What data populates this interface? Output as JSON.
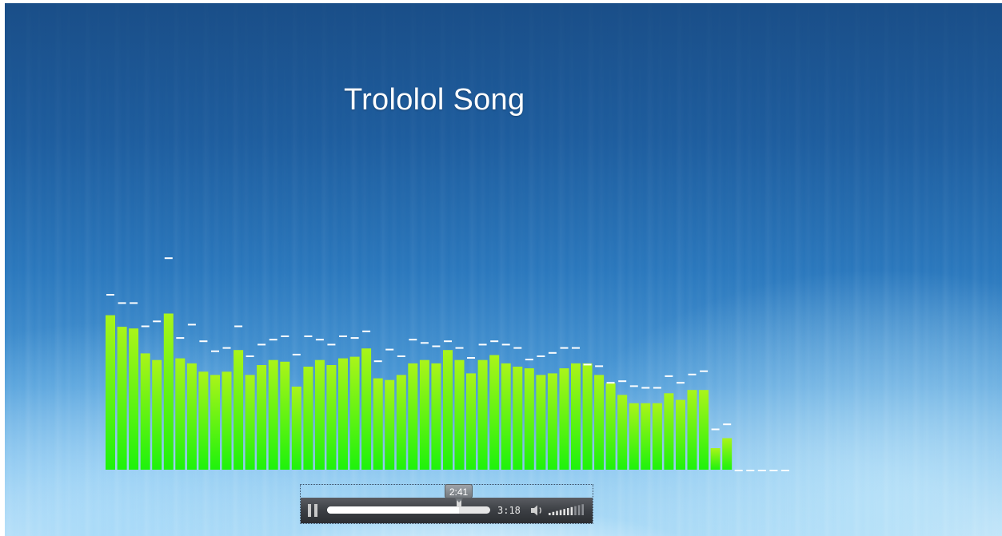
{
  "song": {
    "title": "Trololol Song"
  },
  "player": {
    "state": "playing",
    "current_time": "2:41",
    "duration": "3:18",
    "progress": 0.81,
    "volume": 0.7,
    "pause_icon": "pause-icon",
    "speaker_icon": "speaker-icon",
    "volume_icon": "volume-level-icon"
  },
  "visualizer": {
    "colors": {
      "bar_top": "#aaf41a",
      "bar_bottom": "#1ef20c",
      "peak": "#ffffff"
    },
    "levels": [
      0.93,
      0.86,
      0.85,
      0.7,
      0.66,
      0.94,
      0.67,
      0.64,
      0.59,
      0.57,
      0.59,
      0.72,
      0.57,
      0.63,
      0.66,
      0.65,
      0.5,
      0.62,
      0.66,
      0.63,
      0.67,
      0.68,
      0.73,
      0.55,
      0.54,
      0.57,
      0.64,
      0.66,
      0.64,
      0.72,
      0.66,
      0.58,
      0.66,
      0.69,
      0.64,
      0.62,
      0.61,
      0.57,
      0.58,
      0.61,
      0.64,
      0.64,
      0.57,
      0.52,
      0.45,
      0.4,
      0.4,
      0.4,
      0.46,
      0.42,
      0.48,
      0.48,
      0.13,
      0.19,
      0,
      0,
      0,
      0,
      0
    ],
    "peaks": [
      1.0,
      0.95,
      0.95,
      0.81,
      0.84,
      1.22,
      0.74,
      0.82,
      0.72,
      0.66,
      0.68,
      0.81,
      0.63,
      0.7,
      0.73,
      0.75,
      0.64,
      0.75,
      0.73,
      0.7,
      0.75,
      0.74,
      0.78,
      0.6,
      0.67,
      0.63,
      0.73,
      0.71,
      0.69,
      0.72,
      0.68,
      0.62,
      0.7,
      0.72,
      0.7,
      0.68,
      0.61,
      0.63,
      0.65,
      0.68,
      0.68,
      0.58,
      0.57,
      0.47,
      0.48,
      0.45,
      0.44,
      0.44,
      0.51,
      0.47,
      0.52,
      0.54,
      0.19,
      0.22,
      0,
      0,
      0,
      0,
      0
    ]
  }
}
